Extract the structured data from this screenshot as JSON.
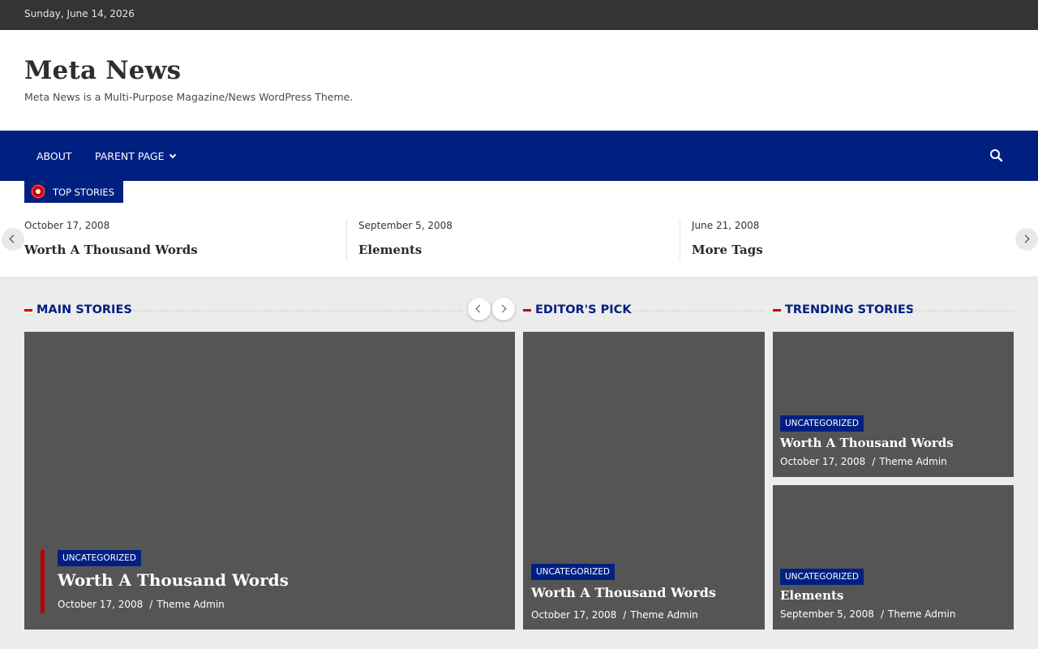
{
  "topbar": {
    "date": "Sunday, June 14, 2026"
  },
  "header": {
    "site_title": "Meta News",
    "tagline": "Meta News is a Multi-Purpose Magazine/News WordPress Theme."
  },
  "nav": {
    "items": [
      {
        "label": "ABOUT"
      },
      {
        "label": "PARENT PAGE"
      }
    ],
    "search_icon": "search-icon"
  },
  "ticker": {
    "badge": "TOP STORIES",
    "items": [
      {
        "date": "October 17, 2008",
        "title": "Worth A Thousand Words"
      },
      {
        "date": "September 5, 2008",
        "title": "Elements"
      },
      {
        "date": "June 21, 2008",
        "title": "More Tags"
      }
    ]
  },
  "sections": {
    "main": {
      "title": "MAIN STORIES"
    },
    "editors": {
      "title": "EDITOR'S PICK"
    },
    "trending": {
      "title": "TRENDING STORIES"
    }
  },
  "main_story": {
    "category": "UNCATEGORIZED",
    "title": "Worth A Thousand Words",
    "date": "October 17, 2008",
    "author": "Theme Admin"
  },
  "editor_pick": {
    "category": "UNCATEGORIZED",
    "title": "Worth A Thousand Words",
    "date": "October 17, 2008",
    "author": "Theme Admin"
  },
  "trending": [
    {
      "category": "UNCATEGORIZED",
      "title": "Worth A Thousand Words",
      "date": "October 17, 2008",
      "author": "Theme Admin"
    },
    {
      "category": "UNCATEGORIZED",
      "title": "Elements",
      "date": "September 5, 2008",
      "author": "Theme Admin"
    }
  ],
  "meta_separator": "/",
  "colors": {
    "brand_blue": "#002081",
    "accent_red": "#cc0000",
    "topbar": "#343434",
    "card_placeholder": "#555555"
  }
}
